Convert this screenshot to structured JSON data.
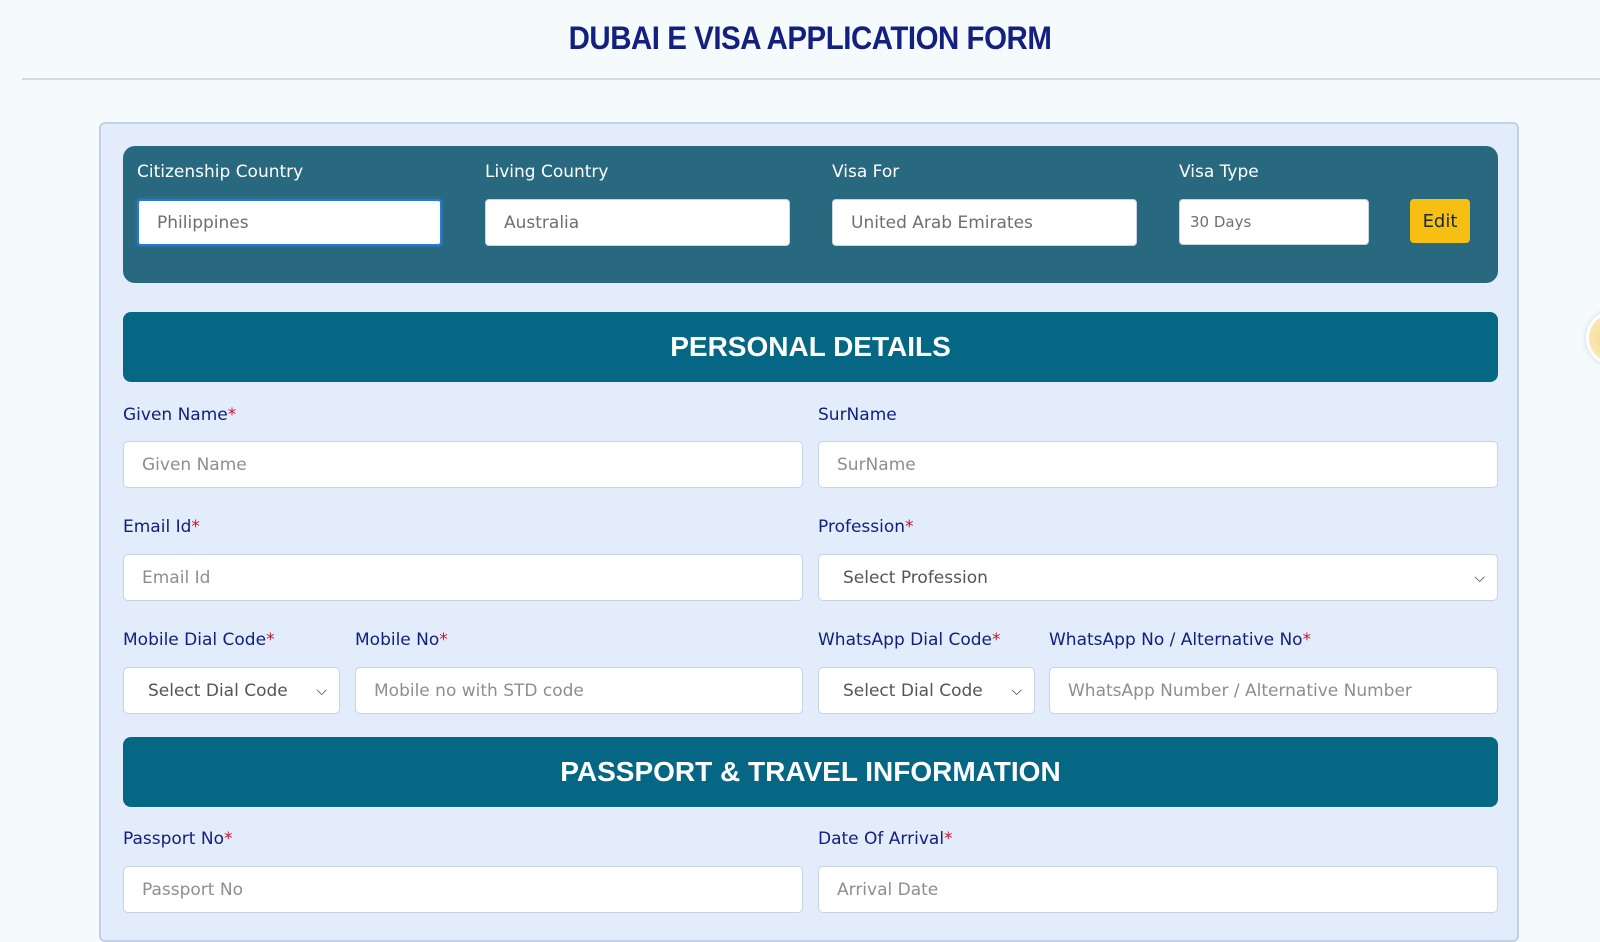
{
  "page_title": "DUBAI E VISA APPLICATION FORM",
  "summary": {
    "citizenship": {
      "label": "Citizenship Country",
      "value": "Philippines"
    },
    "living": {
      "label": "Living Country",
      "value": "Australia"
    },
    "visa_for": {
      "label": "Visa For",
      "value": "United Arab Emirates"
    },
    "visa_type": {
      "label": "Visa Type",
      "value": "30 Days"
    },
    "edit_label": "Edit"
  },
  "sections": {
    "personal": "PERSONAL DETAILS",
    "passport": "PASSPORT & TRAVEL INFORMATION"
  },
  "fields": {
    "given_name": {
      "label": "Given Name",
      "required": "*",
      "placeholder": "Given Name"
    },
    "surname": {
      "label": "SurName",
      "placeholder": "SurName"
    },
    "email": {
      "label": "Email Id",
      "required": "*",
      "placeholder": "Email Id"
    },
    "profession": {
      "label": "Profession",
      "required": "*",
      "selected": "Select Profession"
    },
    "mobile_dial": {
      "label": "Mobile Dial Code",
      "required": "*",
      "selected": "Select Dial Code"
    },
    "mobile_no": {
      "label": "Mobile No",
      "required": "*",
      "placeholder": "Mobile no with STD code"
    },
    "whatsapp_dial": {
      "label": "WhatsApp Dial Code",
      "required": "*",
      "selected": "Select Dial Code"
    },
    "whatsapp_no": {
      "label": "WhatsApp No / Alternative No",
      "required": "*",
      "placeholder": "WhatsApp Number / Alternative Number"
    },
    "passport_no": {
      "label": "Passport No",
      "required": "*",
      "placeholder": "Passport No"
    },
    "arrival": {
      "label": "Date Of Arrival",
      "required": "*",
      "placeholder": "Arrival Date"
    }
  },
  "icons": {
    "chevron": "⌵"
  }
}
